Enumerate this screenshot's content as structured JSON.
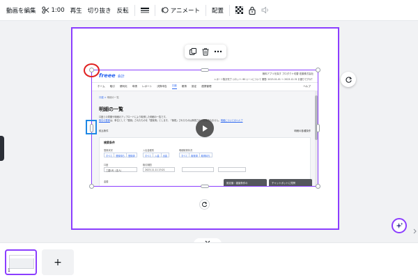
{
  "toolbar": {
    "edit_video": "動画を編集",
    "duration": "1:00",
    "play": "再生",
    "crop": "切り抜き",
    "flip": "反転",
    "animate": "アニメート",
    "arrange": "配置"
  },
  "freee": {
    "logo": "freee",
    "logo_sub": "会計",
    "header_links": "無料アプリを探す   プロダクト切替   佐藤株式会社",
    "header_info": "レポート集計完了   ○ロット: 60   ○ーンについて   期間: 2023-01-01 〜 2023-12-31   お困りですか？",
    "nav": [
      "ホーム",
      "取引",
      "便利化",
      "申請",
      "レポート",
      "決算申告",
      "口座",
      "帳簿",
      "設定",
      "連携管理"
    ],
    "nav_help": "ヘルプ",
    "breadcrumb_home": "口座",
    "breadcrumb_current": "明細の一覧",
    "page_title": "明細の一覧",
    "desc1": "口座との同期や明細のアップロードにより取得した明細の一覧です。",
    "desc2_link1": "取引の登録",
    "desc2_text": "は、単位として「登録」されたものを「登録済」とします。「無視」されたものは無視されて反映されません。",
    "desc2_link2": "明細についてのヘルプ",
    "cond_left": "絞込条件",
    "cond_right": "明細の各種操作",
    "panel_title": "検索条件",
    "label_status": "登録状況",
    "status_options": [
      "すべて",
      "登録待ち",
      "登録済"
    ],
    "label_inout": "入出金種別",
    "inout_options": [
      "すべて",
      "入金",
      "出金"
    ],
    "label_sync": "明細取得状況",
    "sync_options": [
      "すべて",
      "取得済",
      "取得待ち"
    ],
    "label_account": "口座",
    "account_value": "三菱UFJ（法人）",
    "label_date": "取引期間",
    "date_value": "2023-11-11 23:21",
    "label_amount": "金額",
    "bottom_btn1": "設定値・複製条件の",
    "bottom_btn2": "チャットボットに質問"
  },
  "bottom": {
    "page_number": "1",
    "add_page": "+"
  },
  "colors": {
    "accent": "#8b3dff",
    "annotation_red": "#e02020",
    "annotation_blue": "#1e88e5",
    "freee_blue": "#2864f0"
  }
}
